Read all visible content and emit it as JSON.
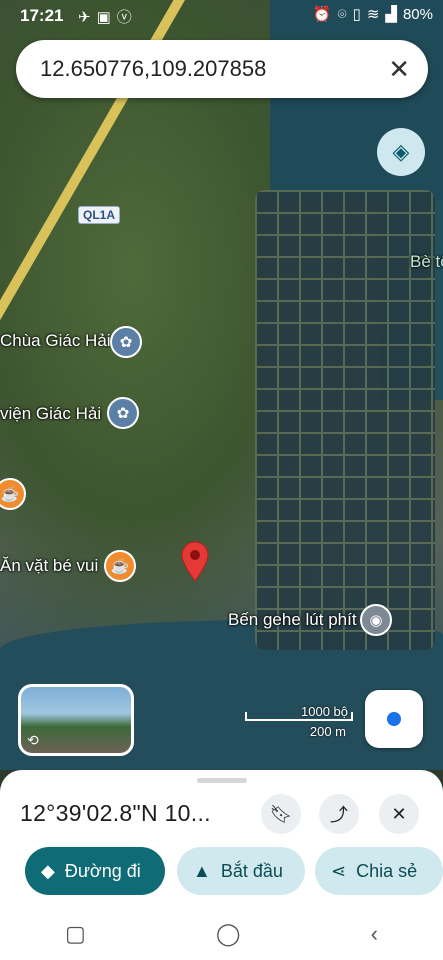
{
  "status_bar": {
    "time": "17:21",
    "battery": "80%",
    "left_icons": [
      "nav-icon",
      "image-icon",
      "v-icon"
    ]
  },
  "search": {
    "query": "12.650776,109.207858"
  },
  "map": {
    "places": {
      "chua": "Chùa Giác Hải",
      "vien": "viện Giác Hải",
      "be": "Bè tô",
      "anvat": "Ăn vặt bé vui",
      "ben": "Bến gehe lút phít"
    },
    "road_label": "QL1A",
    "scale": {
      "imperial": "1000 bộ",
      "metric": "200 m"
    }
  },
  "sheet": {
    "coords": "12°39'02.8\"N 10...",
    "actions": {
      "directions": "Đường đi",
      "start": "Bắt đầu",
      "share": "Chia sẻ"
    }
  }
}
